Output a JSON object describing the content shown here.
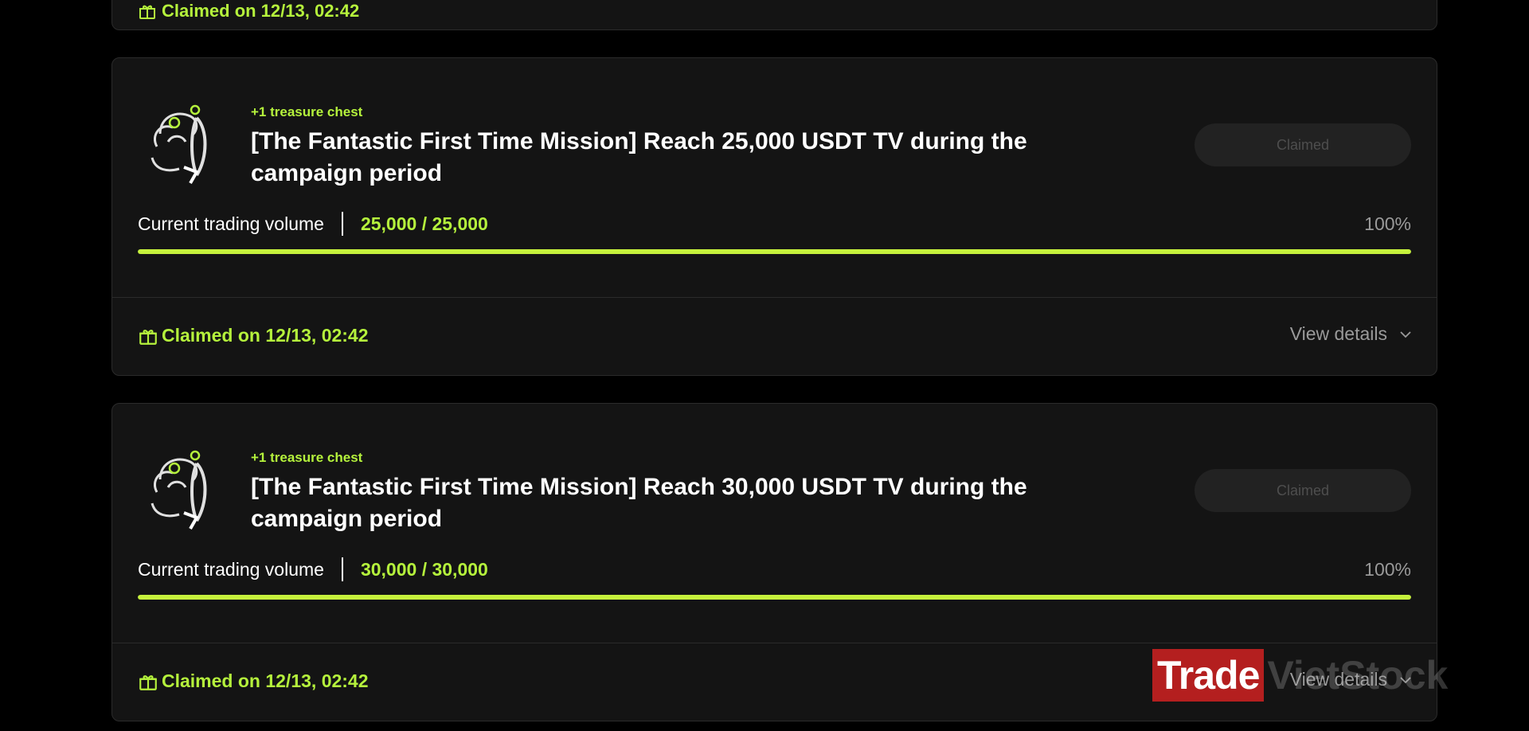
{
  "top_card": {
    "claimed_text": "Claimed on 12/13, 02:42"
  },
  "missions": [
    {
      "reward": "+1 treasure chest",
      "title": "[The Fantastic First Time Mission] Reach 25,000 USDT TV during the campaign period",
      "button_label": "Claimed",
      "volume_label": "Current trading volume",
      "volume_value": "25,000 / 25,000",
      "percent_text": "100%",
      "progress": 1.0,
      "claimed_text": "Claimed on 12/13, 02:42",
      "details_label": "View details"
    },
    {
      "reward": "+1 treasure chest",
      "title": "[The Fantastic First Time Mission] Reach 30,000 USDT TV during the campaign period",
      "button_label": "Claimed",
      "volume_label": "Current trading volume",
      "volume_value": "30,000 / 30,000",
      "percent_text": "100%",
      "progress": 1.0,
      "claimed_text": "Claimed on 12/13, 02:42",
      "details_label": "View details"
    }
  ],
  "watermark": {
    "brand": "Trade",
    "suffix": "VietStock"
  },
  "colors": {
    "accent": "#b5f23c",
    "card_bg": "#141414",
    "page_bg": "#000000"
  },
  "icons": {
    "mascot": "surfer-mascot-icon",
    "gift": "gift-icon",
    "chevron": "chevron-down-icon"
  }
}
